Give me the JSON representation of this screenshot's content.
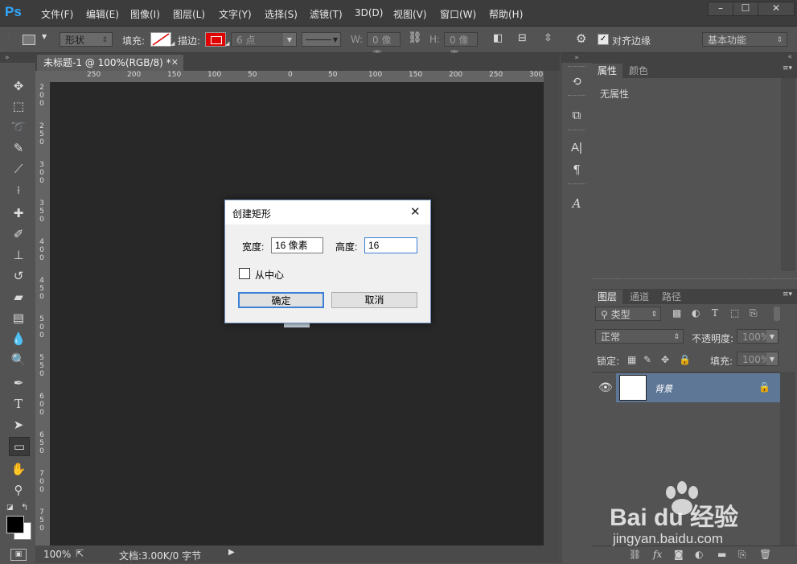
{
  "app": {
    "logo": "Ps"
  },
  "menu": [
    "文件(F)",
    "编辑(E)",
    "图像(I)",
    "图层(L)",
    "文字(Y)",
    "选择(S)",
    "滤镜(T)",
    "3D(D)",
    "视图(V)",
    "窗口(W)",
    "帮助(H)"
  ],
  "window_buttons": [
    "–",
    "☐",
    "✕"
  ],
  "options": {
    "mode": "形状",
    "fill_label": "填充:",
    "stroke_label": "描边:",
    "stroke_width": "6 点",
    "w_label": "W:",
    "w_value": "0 像素",
    "h_label": "H:",
    "h_value": "0 像素",
    "align_edges": "对齐边缘",
    "workspace": "基本功能"
  },
  "document": {
    "tab_title": "未标题-1 @ 100%(RGB/8) *",
    "ruler_h": [
      "250",
      "200",
      "150",
      "100",
      "50",
      "0",
      "50",
      "100",
      "150",
      "200",
      "250",
      "300"
    ],
    "ruler_v": [
      "2\n0\n0",
      "2\n5\n0",
      "3\n0\n0",
      "3\n5\n0",
      "4\n0\n0",
      "4\n5\n0",
      "5\n0\n0",
      "5\n5\n0",
      "6\n0\n0",
      "6\n5\n0",
      "7\n0\n0",
      "7\n5\n0"
    ]
  },
  "status": {
    "zoom": "100%",
    "doc_info": "文档:3.00K/0 字节"
  },
  "dialog": {
    "title": "创建矩形",
    "width_label": "宽度:",
    "width_value": "16 像素",
    "height_label": "高度:",
    "height_value": "16",
    "from_center": "从中心",
    "ok": "确定",
    "cancel": "取消"
  },
  "properties_panel": {
    "tabs": [
      "属性",
      "颜色"
    ],
    "content": "无属性"
  },
  "layers_panel": {
    "tabs": [
      "图层",
      "通道",
      "路径"
    ],
    "filter": "类型",
    "blend_mode": "正常",
    "opacity_label": "不透明度:",
    "opacity_value": "100%",
    "lock_label": "锁定:",
    "fill_label": "填充:",
    "fill_value": "100%",
    "layers": [
      {
        "name": "背景",
        "locked": true,
        "visible": true
      }
    ]
  },
  "watermark": {
    "brand": "Bai du 经验",
    "url": "jingyan.baidu.com"
  },
  "colors": {
    "accent": "#31a8ff",
    "stroke": "#e00000",
    "layer_selected": "#5f7797"
  }
}
